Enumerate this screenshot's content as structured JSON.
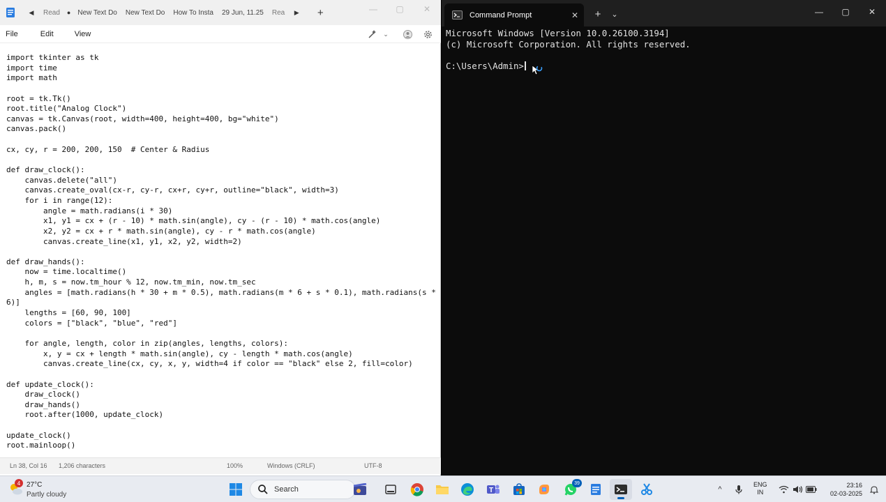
{
  "notepad": {
    "tabs": [
      "Read",
      "New Text Do",
      "New Text Do",
      "How To Insta",
      "29 Jun, 11.25",
      "Rea"
    ],
    "menus": [
      "File",
      "Edit",
      "View"
    ],
    "code_lines": [
      "import tkinter as tk",
      "import time",
      "import math",
      "",
      "root = tk.Tk()",
      "root.title(\"Analog Clock\")",
      "canvas = tk.Canvas(root, width=400, height=400, bg=\"white\")",
      "canvas.pack()",
      "",
      "cx, cy, r = 200, 200, 150  # Center & Radius",
      "",
      "def draw_clock():",
      "    canvas.delete(\"all\")",
      "    canvas.create_oval(cx-r, cy-r, cx+r, cy+r, outline=\"black\", width=3)",
      "    for i in range(12):",
      "        angle = math.radians(i * 30)",
      "        x1, y1 = cx + (r - 10) * math.sin(angle), cy - (r - 10) * math.cos(angle)",
      "        x2, y2 = cx + r * math.sin(angle), cy - r * math.cos(angle)",
      "        canvas.create_line(x1, y1, x2, y2, width=2)",
      "",
      "def draw_hands():",
      "    now = time.localtime()",
      "    h, m, s = now.tm_hour % 12, now.tm_min, now.tm_sec",
      "    angles = [math.radians(h * 30 + m * 0.5), math.radians(m * 6 + s * 0.1), math.radians(s *",
      "6)]",
      "    lengths = [60, 90, 100]",
      "    colors = [\"black\", \"blue\", \"red\"]",
      "",
      "    for angle, length, color in zip(angles, lengths, colors):",
      "        x, y = cx + length * math.sin(angle), cy - length * math.cos(angle)",
      "        canvas.create_line(cx, cy, x, y, width=4 if color == \"black\" else 2, fill=color)",
      "",
      "def update_clock():",
      "    draw_clock()",
      "    draw_hands()",
      "    root.after(1000, update_clock)",
      "",
      "update_clock()",
      "root.mainloop()"
    ],
    "status": {
      "position": "Ln 38, Col 16",
      "characters": "1,206 characters",
      "zoom": "100%",
      "line_ending": "Windows (CRLF)",
      "encoding": "UTF-8"
    }
  },
  "terminal": {
    "tab_title": "Command Prompt",
    "output_lines": [
      "Microsoft Windows [Version 10.0.26100.3194]",
      "(c) Microsoft Corporation. All rights reserved."
    ],
    "prompt": "C:\\Users\\Admin>"
  },
  "taskbar": {
    "weather": {
      "temp": "27°C",
      "condition": "Partly cloudy",
      "badge": "4"
    },
    "search_label": "Search",
    "whatsapp_badge": "39",
    "language": [
      "ENG",
      "IN"
    ],
    "time": "23:16",
    "date": "02-03-2025"
  },
  "colors": {
    "accent": "#005fb8",
    "terminal_bg": "#0c0c0c",
    "terminal_titlebar": "#1f1f1f"
  }
}
